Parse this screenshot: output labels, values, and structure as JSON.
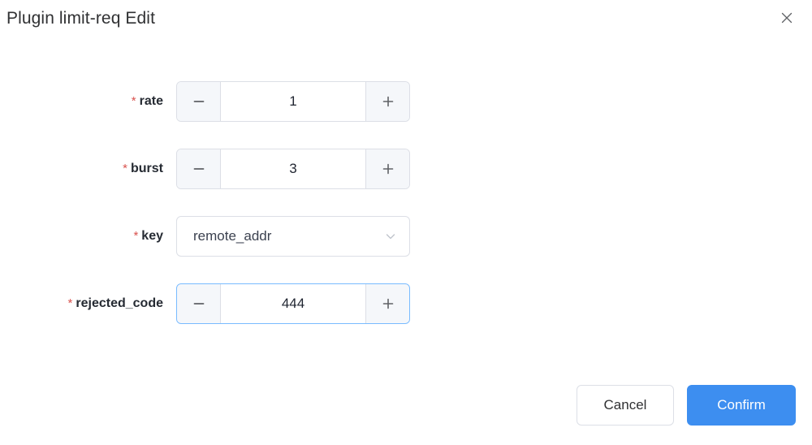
{
  "dialog": {
    "title": "Plugin limit-req Edit",
    "close_icon": "close-icon"
  },
  "form": {
    "fields": [
      {
        "label": "rate",
        "required_marker": "*",
        "type": "number-stepper",
        "value": "1",
        "decrement_icon": "minus-icon",
        "increment_icon": "plus-icon",
        "focused": false
      },
      {
        "label": "burst",
        "required_marker": "*",
        "type": "number-stepper",
        "value": "3",
        "decrement_icon": "minus-icon",
        "increment_icon": "plus-icon",
        "focused": false
      },
      {
        "label": "key",
        "required_marker": "*",
        "type": "select",
        "value": "remote_addr",
        "dropdown_icon": "chevron-down-icon",
        "focused": false
      },
      {
        "label": "rejected_code",
        "required_marker": "*",
        "type": "number-stepper",
        "value": "444",
        "decrement_icon": "minus-icon",
        "increment_icon": "plus-icon",
        "focused": true
      }
    ]
  },
  "footer": {
    "cancel_label": "Cancel",
    "confirm_label": "Confirm"
  },
  "colors": {
    "primary": "#3d8ef0",
    "required": "#d9534f",
    "border": "#dcdfe6",
    "focus_border": "#79bbff",
    "step_button_bg": "#f5f7fa",
    "text": "#303133"
  }
}
